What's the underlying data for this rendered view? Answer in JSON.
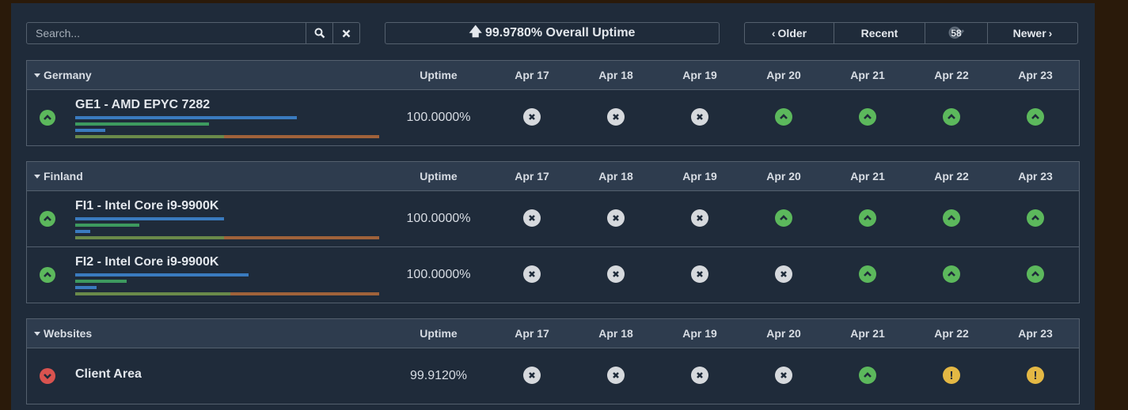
{
  "search": {
    "placeholder": "Search..."
  },
  "overall_uptime": "99.9780% Overall Uptime",
  "nav": {
    "older": "Older",
    "recent": "Recent",
    "refresh_count": "58",
    "newer": "Newer"
  },
  "columns": {
    "uptime": "Uptime",
    "days": [
      "Apr 17",
      "Apr 18",
      "Apr 19",
      "Apr 20",
      "Apr 21",
      "Apr 22",
      "Apr 23"
    ]
  },
  "groups": [
    {
      "name": "Germany",
      "servers": [
        {
          "name": "GE1 - AMD EPYC 7282",
          "status": "up",
          "uptime": "100.0000%",
          "bars": [
            0.73,
            0.44,
            0.1,
            0.49
          ],
          "days": [
            "none",
            "none",
            "none",
            "up",
            "up",
            "up",
            "up"
          ]
        }
      ]
    },
    {
      "name": "Finland",
      "servers": [
        {
          "name": "FI1 - Intel Core i9-9900K",
          "status": "up",
          "uptime": "100.0000%",
          "bars": [
            0.49,
            0.21,
            0.05,
            0.49
          ],
          "days": [
            "none",
            "none",
            "none",
            "up",
            "up",
            "up",
            "up"
          ]
        },
        {
          "name": "FI2 - Intel Core i9-9900K",
          "status": "up",
          "uptime": "100.0000%",
          "bars": [
            0.57,
            0.17,
            0.07,
            0.51
          ],
          "days": [
            "none",
            "none",
            "none",
            "none",
            "up",
            "up",
            "up"
          ]
        }
      ]
    },
    {
      "name": "Websites",
      "servers": [
        {
          "name": "Client Area",
          "status": "down",
          "uptime": "99.9120%",
          "bars": [],
          "days": [
            "none",
            "none",
            "none",
            "none",
            "up",
            "warn",
            "warn"
          ]
        }
      ]
    }
  ]
}
